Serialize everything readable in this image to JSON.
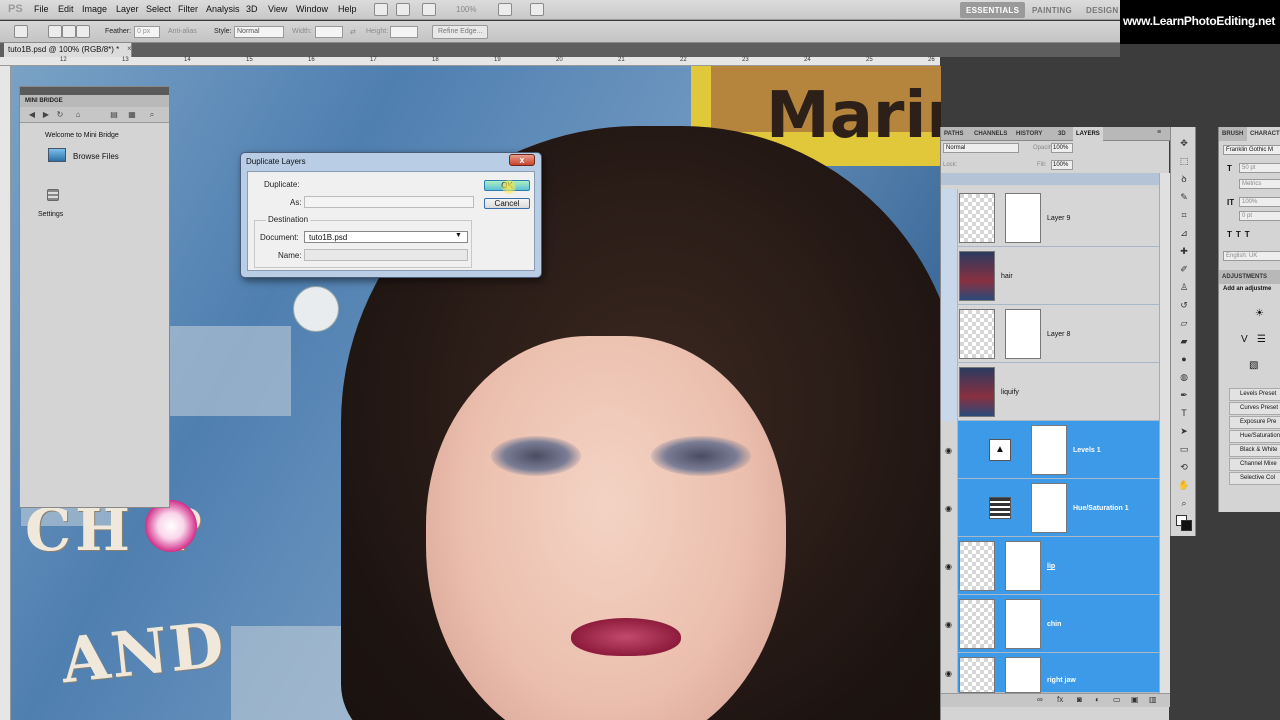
{
  "app": {
    "logo": "PS"
  },
  "menu": [
    "File",
    "Edit",
    "Image",
    "Layer",
    "Select",
    "Filter",
    "Analysis",
    "3D",
    "View",
    "Window",
    "Help"
  ],
  "zoom_display": "100%",
  "workspaces": {
    "essentials": "ESSENTIALS",
    "painting": "PAINTING",
    "design": "DESIGN"
  },
  "watermark": "www.LearnPhotoEditing.net",
  "options": {
    "feather_label": "Feather:",
    "feather_value": "0 px",
    "anti_alias": "Anti-alias",
    "style_label": "Style:",
    "style_value": "Normal",
    "width_label": "Width:",
    "height_label": "Height:",
    "refine_edge": "Refine Edge..."
  },
  "document": {
    "tab_title": "tuto1B.psd @ 100% (RGB/8*) *",
    "close": "×"
  },
  "ruler_ticks": [
    "12",
    "13",
    "14",
    "15",
    "16",
    "17",
    "18",
    "19",
    "20",
    "21",
    "22",
    "23",
    "24",
    "25",
    "26"
  ],
  "canvas_text": {
    "chop": "CH  P",
    "and": "AND",
    "marin": "Marin"
  },
  "mini_bridge": {
    "title": "MINI BRIDGE",
    "welcome": "Welcome to Mini Bridge",
    "browse_files": "Browse Files",
    "settings": "Settings"
  },
  "dialog": {
    "title": "Duplicate Layers",
    "duplicate_label": "Duplicate:",
    "as_label": "As:",
    "destination_label": "Destination",
    "document_label": "Document:",
    "document_value": "tuto1B.psd",
    "name_label": "Name:",
    "ok": "OK",
    "cancel": "Cancel",
    "close": "x"
  },
  "layers_panel": {
    "tabs": [
      "PATHS",
      "CHANNELS",
      "HISTORY",
      "3D",
      "LAYERS"
    ],
    "blend_mode": "Normal",
    "opacity_label": "Opacity:",
    "opacity_value": "100%",
    "lock_label": "Lock:",
    "fill_label": "Fill:",
    "fill_value": "100%",
    "layers": [
      {
        "name": "Layer 9",
        "selected": false
      },
      {
        "name": "hair",
        "selected": false
      },
      {
        "name": "Layer 8",
        "selected": false
      },
      {
        "name": "liquify",
        "selected": false
      },
      {
        "name": "Levels 1",
        "selected": true
      },
      {
        "name": "Hue/Saturation 1",
        "selected": true
      },
      {
        "name": "lip",
        "selected": true
      },
      {
        "name": "chin",
        "selected": true
      },
      {
        "name": "right jaw",
        "selected": true
      }
    ]
  },
  "character_panel": {
    "tabs": [
      "BRUSH",
      "CHARACTER"
    ],
    "font": "Franklin Gothic M",
    "size": "50 pt",
    "kerning": "Metrics",
    "scale": "100%",
    "baseline": "0 pt",
    "language": "English: UK"
  },
  "adjustments_panel": {
    "title": "ADJUSTMENTS",
    "subtitle": "Add an adjustme",
    "presets": [
      "Levels Preset",
      "Curves Preset",
      "Exposure Pre",
      "Hue/Saturation",
      "Black & White",
      "Channel Mixe",
      "Selective Col"
    ]
  },
  "colors": {
    "selection_blue": "#3c9ae8",
    "dialog_frame": "#b9cde4",
    "close_red": "#c8402a"
  }
}
